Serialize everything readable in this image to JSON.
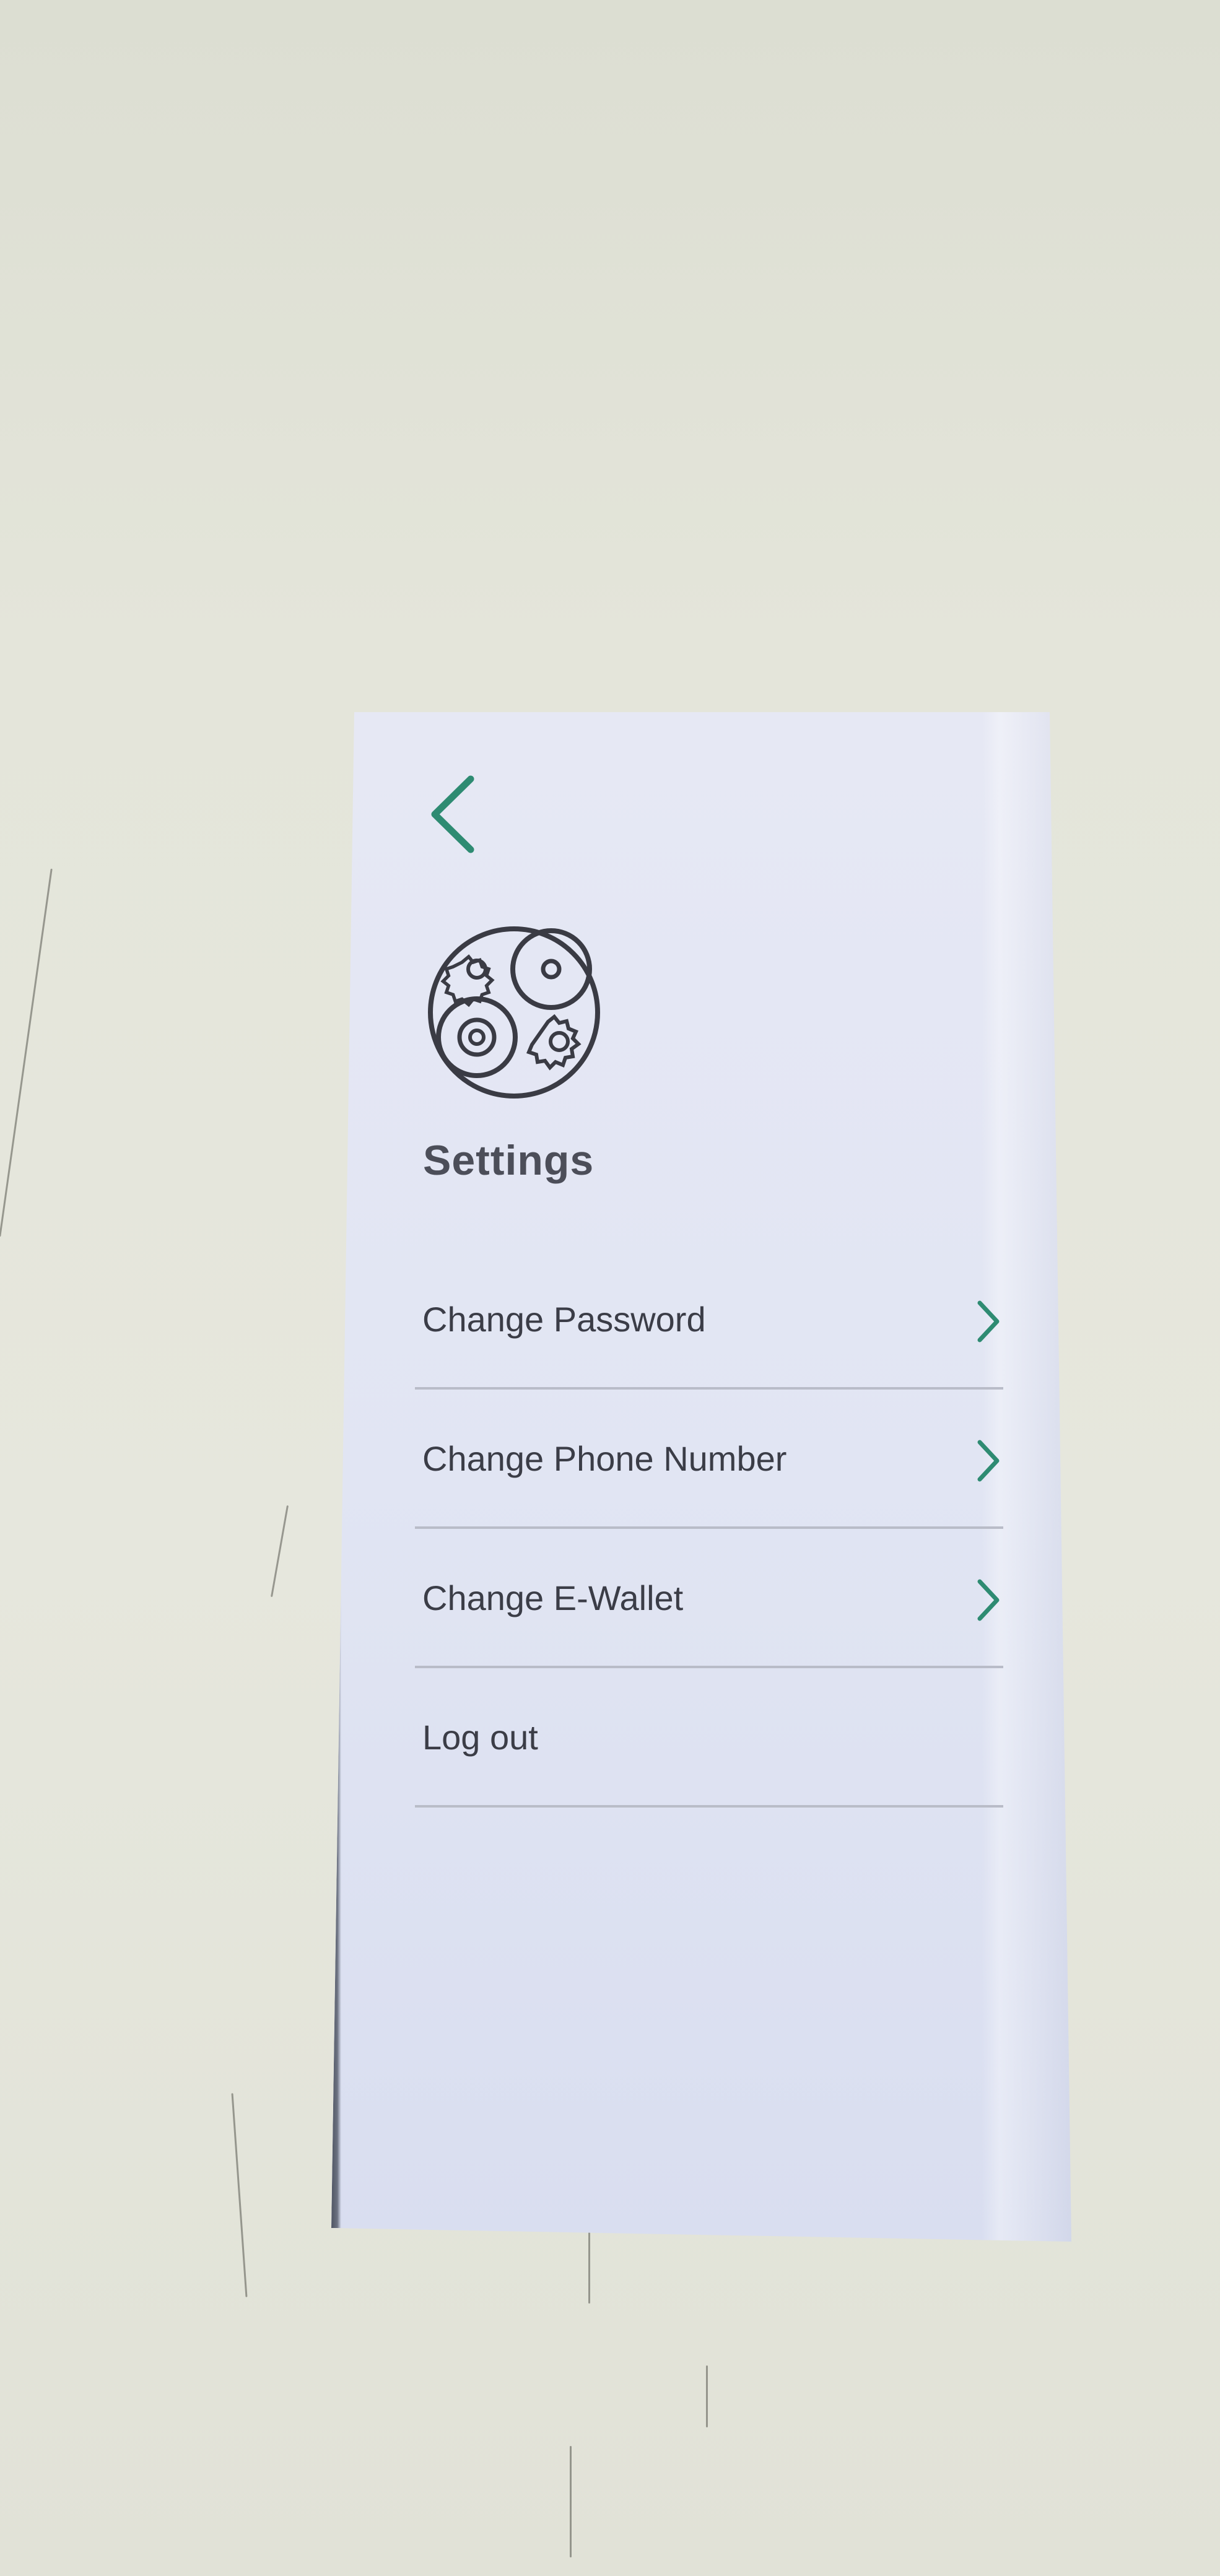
{
  "colors": {
    "accent": "#2e8b72",
    "text": "#3b3d47",
    "divider": "#b9bcc8",
    "icon_stroke": "#3a3b44"
  },
  "header": {
    "back_icon": "chevron-left-icon",
    "settings_icon": "gears-circle-icon",
    "title": "Settings"
  },
  "menu": {
    "items": [
      {
        "label": "Change Password",
        "icon": "chevron-right-icon"
      },
      {
        "label": "Change Phone Number",
        "icon": "chevron-right-icon"
      },
      {
        "label": "Change E-Wallet",
        "icon": "chevron-right-icon"
      },
      {
        "label": "Log out"
      }
    ]
  }
}
